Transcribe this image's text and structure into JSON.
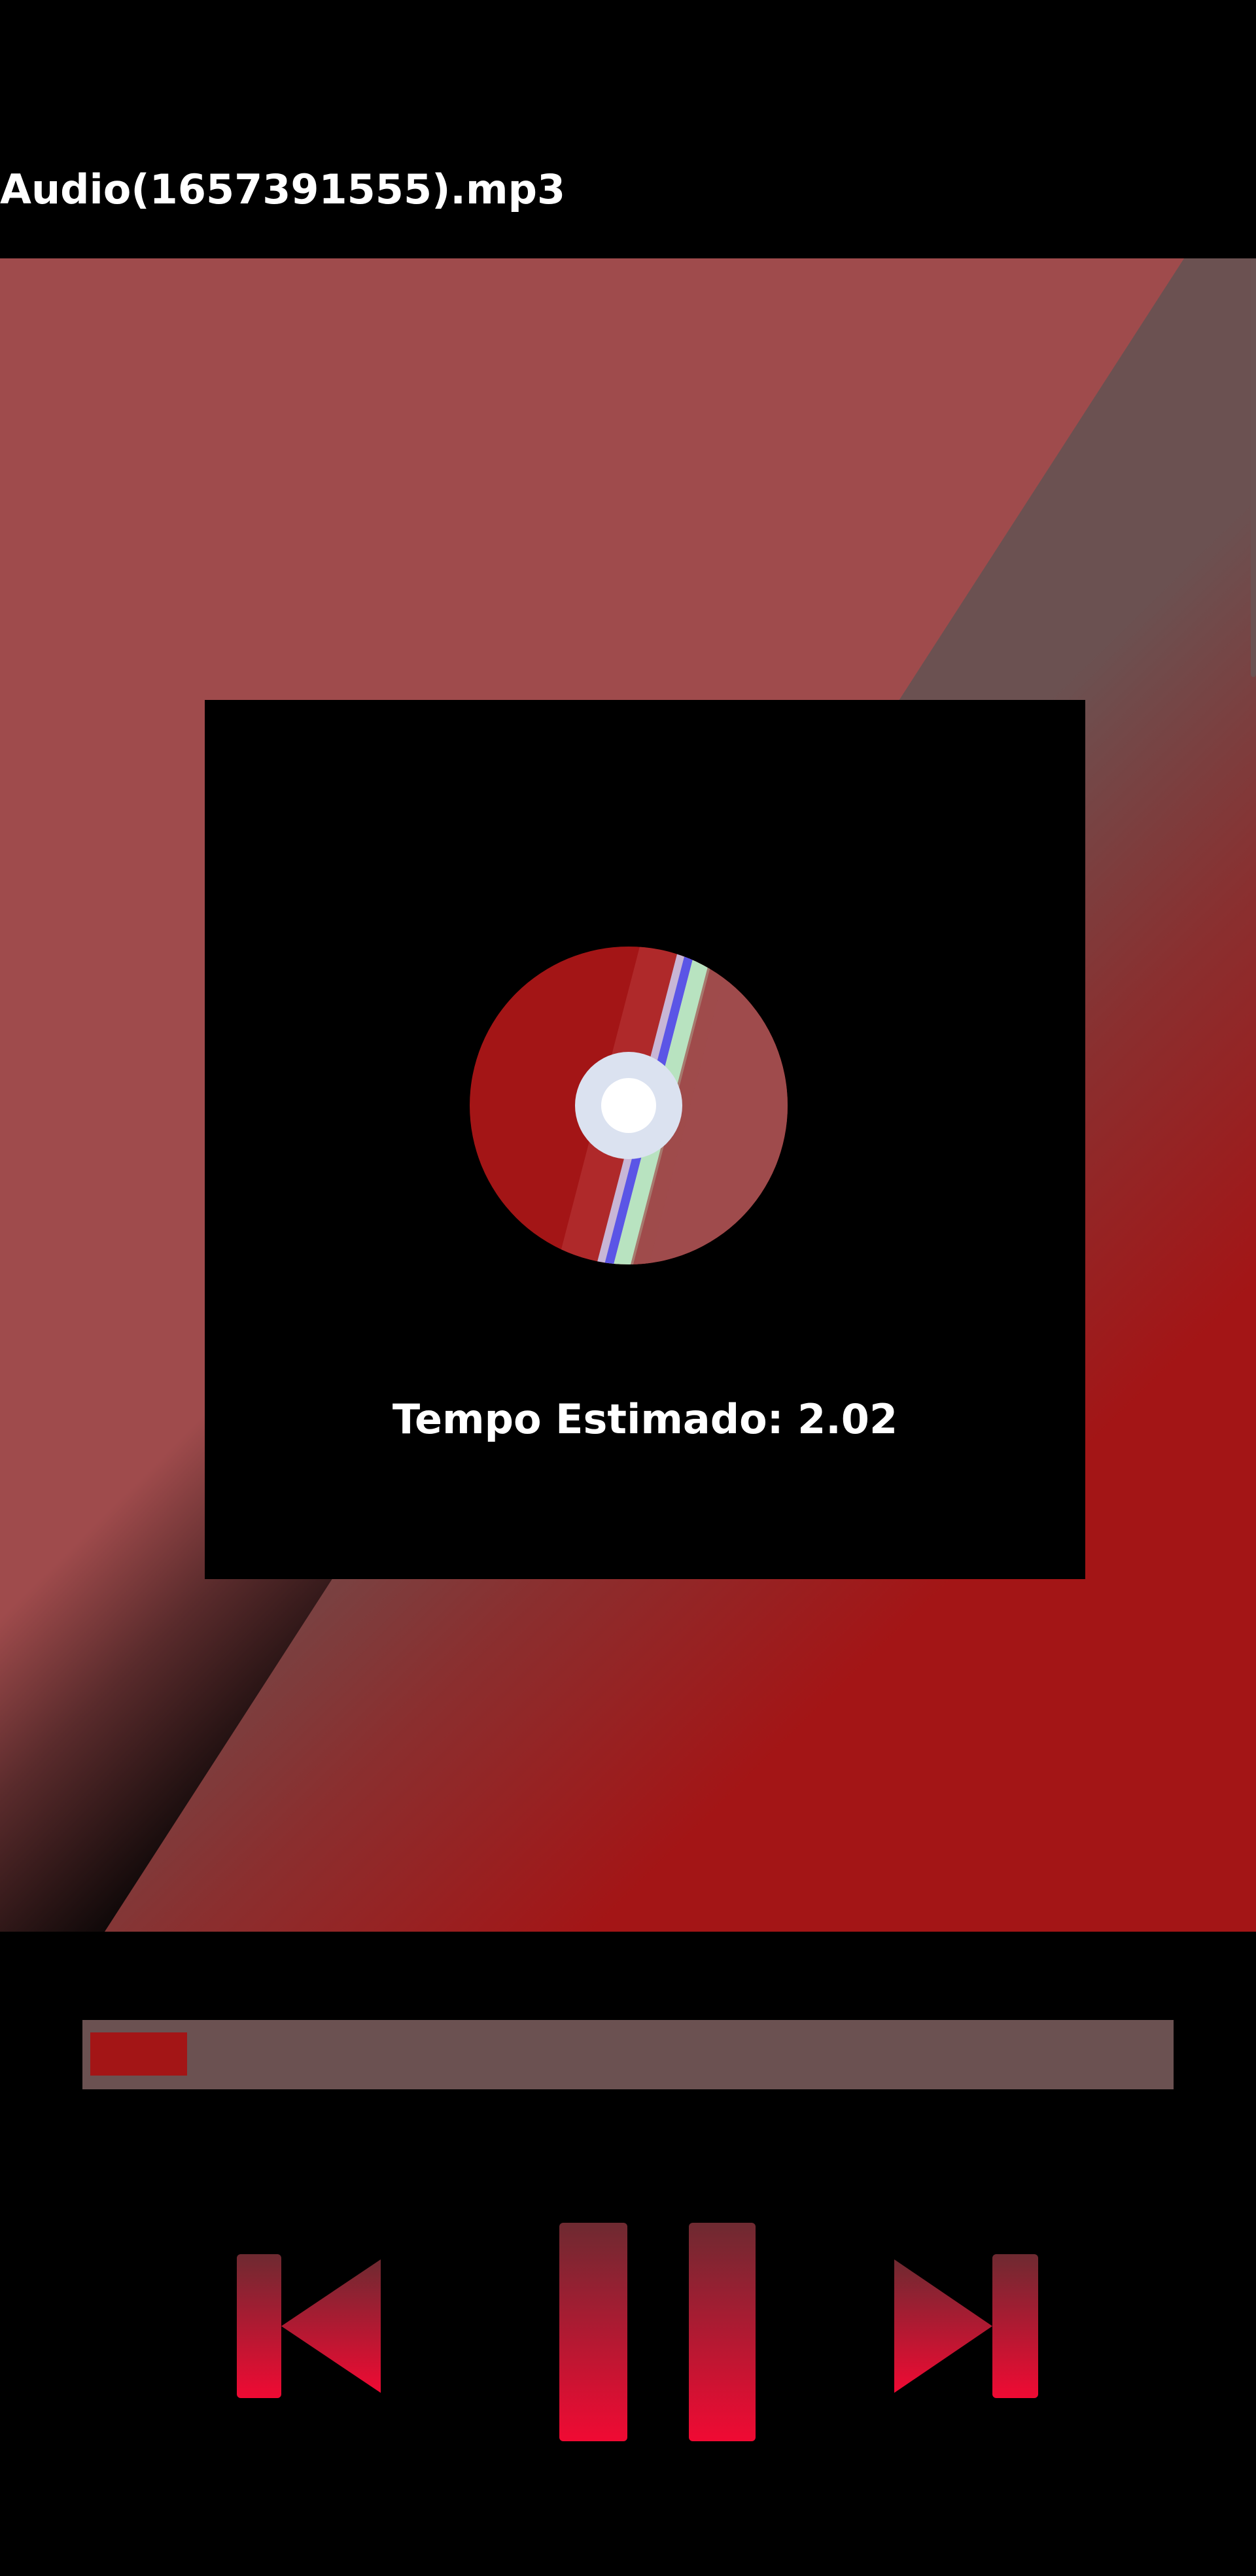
{
  "file": {
    "title": "Audio(1657391555).mp3"
  },
  "player": {
    "estimated_time_label": "Tempo Estimado: 2.02",
    "progress_fraction": 0.09
  },
  "controls": {
    "previous_icon": "skip-previous-icon",
    "pause_icon": "pause-icon",
    "next_icon": "skip-next-icon"
  },
  "colors": {
    "background": "#000000",
    "accent_red": "#a31516",
    "dusty_rose": "#9f4b4c",
    "mauve": "#6b5151",
    "control_gradient_top": "#6e2a31",
    "control_gradient_bottom": "#f00a33"
  }
}
